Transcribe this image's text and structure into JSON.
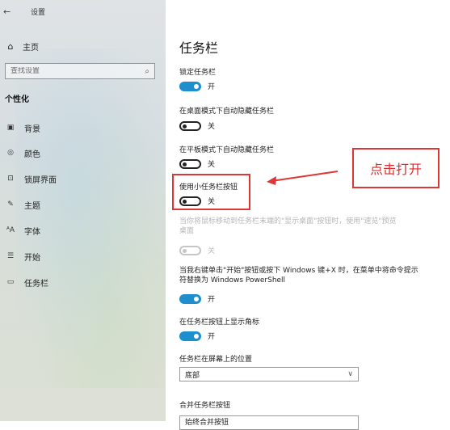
{
  "window": {
    "back_symbol": "←",
    "title": "设置"
  },
  "sidebar": {
    "home_label": "主页",
    "search": {
      "placeholder": "查找设置"
    },
    "section_title": "个性化",
    "items": [
      {
        "label": "背景",
        "icon": "image-icon"
      },
      {
        "label": "颜色",
        "icon": "palette-icon"
      },
      {
        "label": "锁屏界面",
        "icon": "lock-screen-icon"
      },
      {
        "label": "主题",
        "icon": "theme-brush-icon"
      },
      {
        "label": "字体",
        "icon": "font-icon"
      },
      {
        "label": "开始",
        "icon": "start-menu-icon"
      },
      {
        "label": "任务栏",
        "icon": "taskbar-icon",
        "selected": true
      }
    ]
  },
  "main": {
    "title": "任务栏",
    "settings": {
      "lock_taskbar": {
        "label": "锁定任务栏",
        "state": "开",
        "on": true
      },
      "autohide_desktop": {
        "label": "在桌面模式下自动隐藏任务栏",
        "state": "关",
        "on": false
      },
      "autohide_tablet": {
        "label": "在平板模式下自动隐藏任务栏",
        "state": "关",
        "on": false
      },
      "small_buttons": {
        "label": "使用小任务栏按钮",
        "state": "关",
        "on": false
      },
      "peek": {
        "label": "当你将鼠标移动到任务栏末端的\"显示桌面\"按钮时，使用\"速览\"预览桌面",
        "state": "关",
        "enabled": false
      },
      "powershell": {
        "label": "当我右键单击\"开始\"按钮或按下 Windows 键+X 时，在菜单中将命令提示符替换为 Windows PowerShell",
        "state": "开",
        "on": true
      },
      "badges": {
        "label": "在任务栏按钮上显示角标",
        "state": "开",
        "on": true
      },
      "location": {
        "label": "任务栏在屏幕上的位置",
        "value": "底部"
      },
      "combine": {
        "label": "合并任务栏按钮",
        "value": "始终合并按钮"
      }
    }
  },
  "annotation": {
    "callout_text": "点击打开",
    "color": "#e03535"
  },
  "colors": {
    "toggle_on": "#1e8fce",
    "accent_red": "#e03535"
  }
}
